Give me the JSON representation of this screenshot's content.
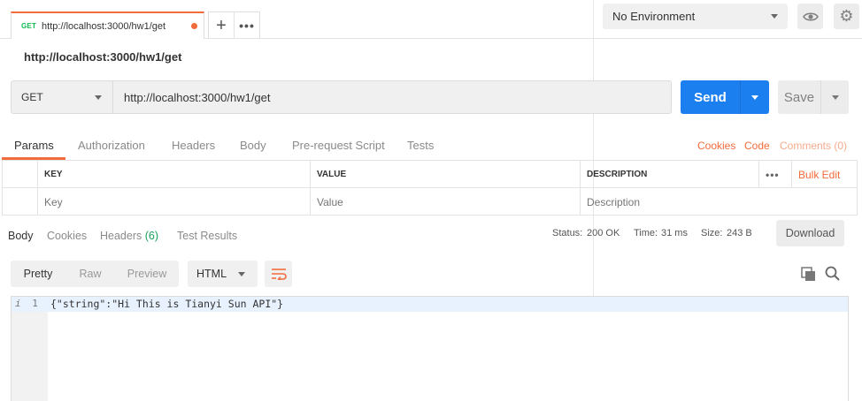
{
  "tab": {
    "method": "GET",
    "url": "http://localhost:3000/hw1/get"
  },
  "tabbar": {
    "new_tab_label": "+",
    "more_label": "•••"
  },
  "environment": {
    "selected": "No Environment"
  },
  "request": {
    "name": "http://localhost:3000/hw1/get",
    "method": "GET",
    "url": "http://localhost:3000/hw1/get",
    "send_label": "Send",
    "save_label": "Save"
  },
  "request_tabs": [
    {
      "label": "Params"
    },
    {
      "label": "Authorization"
    },
    {
      "label": "Headers"
    },
    {
      "label": "Body"
    },
    {
      "label": "Pre-request Script"
    },
    {
      "label": "Tests"
    }
  ],
  "request_links": {
    "cookies": "Cookies",
    "code": "Code",
    "comments": "Comments (0)"
  },
  "params": {
    "headers": {
      "key": "KEY",
      "value": "VALUE",
      "description": "DESCRIPTION"
    },
    "more_label": "•••",
    "bulk_edit": "Bulk Edit",
    "placeholders": {
      "key": "Key",
      "value": "Value",
      "description": "Description"
    }
  },
  "response": {
    "tabs": {
      "body": "Body",
      "cookies": "Cookies",
      "headers": "Headers",
      "headers_count": "(6)",
      "tests": "Test Results"
    },
    "status_label": "Status:",
    "status_value": "200 OK",
    "time_label": "Time:",
    "time_value": "31 ms",
    "size_label": "Size:",
    "size_value": "243 B",
    "download_label": "Download",
    "formats": [
      "Pretty",
      "Raw",
      "Preview"
    ],
    "language": "HTML",
    "line_info_icon": "i",
    "line_number": "1",
    "body_text": "{\"string\":\"Hi This is Tianyi Sun API\"}"
  },
  "colors": {
    "accent": "#f26b3a",
    "send": "#1c7ff0",
    "status_ok": "#17a35b"
  }
}
